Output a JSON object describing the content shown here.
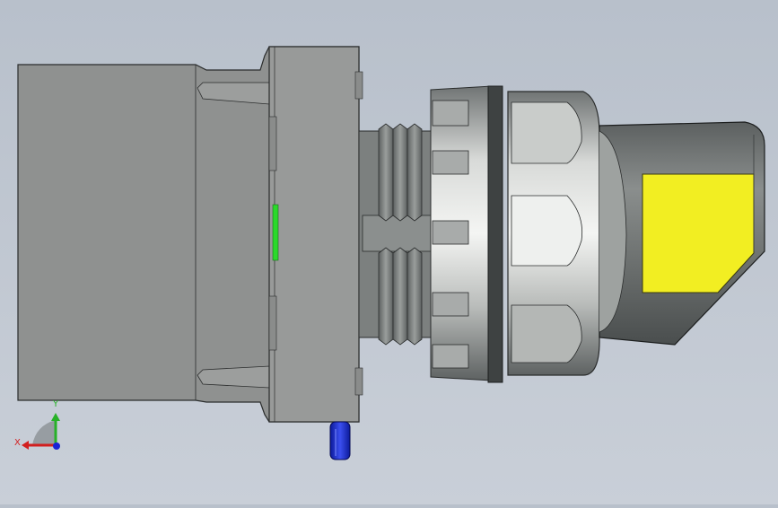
{
  "viewport": {
    "background_top": "#b8c0cb",
    "background_bottom": "#c9cfd8"
  },
  "model": {
    "body_color": "#8f9190",
    "edge_color": "#2a2c2c",
    "indicator_color": "#2bd92b",
    "knob_color": "#f2ee22",
    "button_color": "#1a2fc8"
  },
  "triad": {
    "x_label": "X",
    "y_label": "Y",
    "x_color": "#d21f1f",
    "y_color": "#27b127",
    "z_color": "#1a22d6"
  }
}
